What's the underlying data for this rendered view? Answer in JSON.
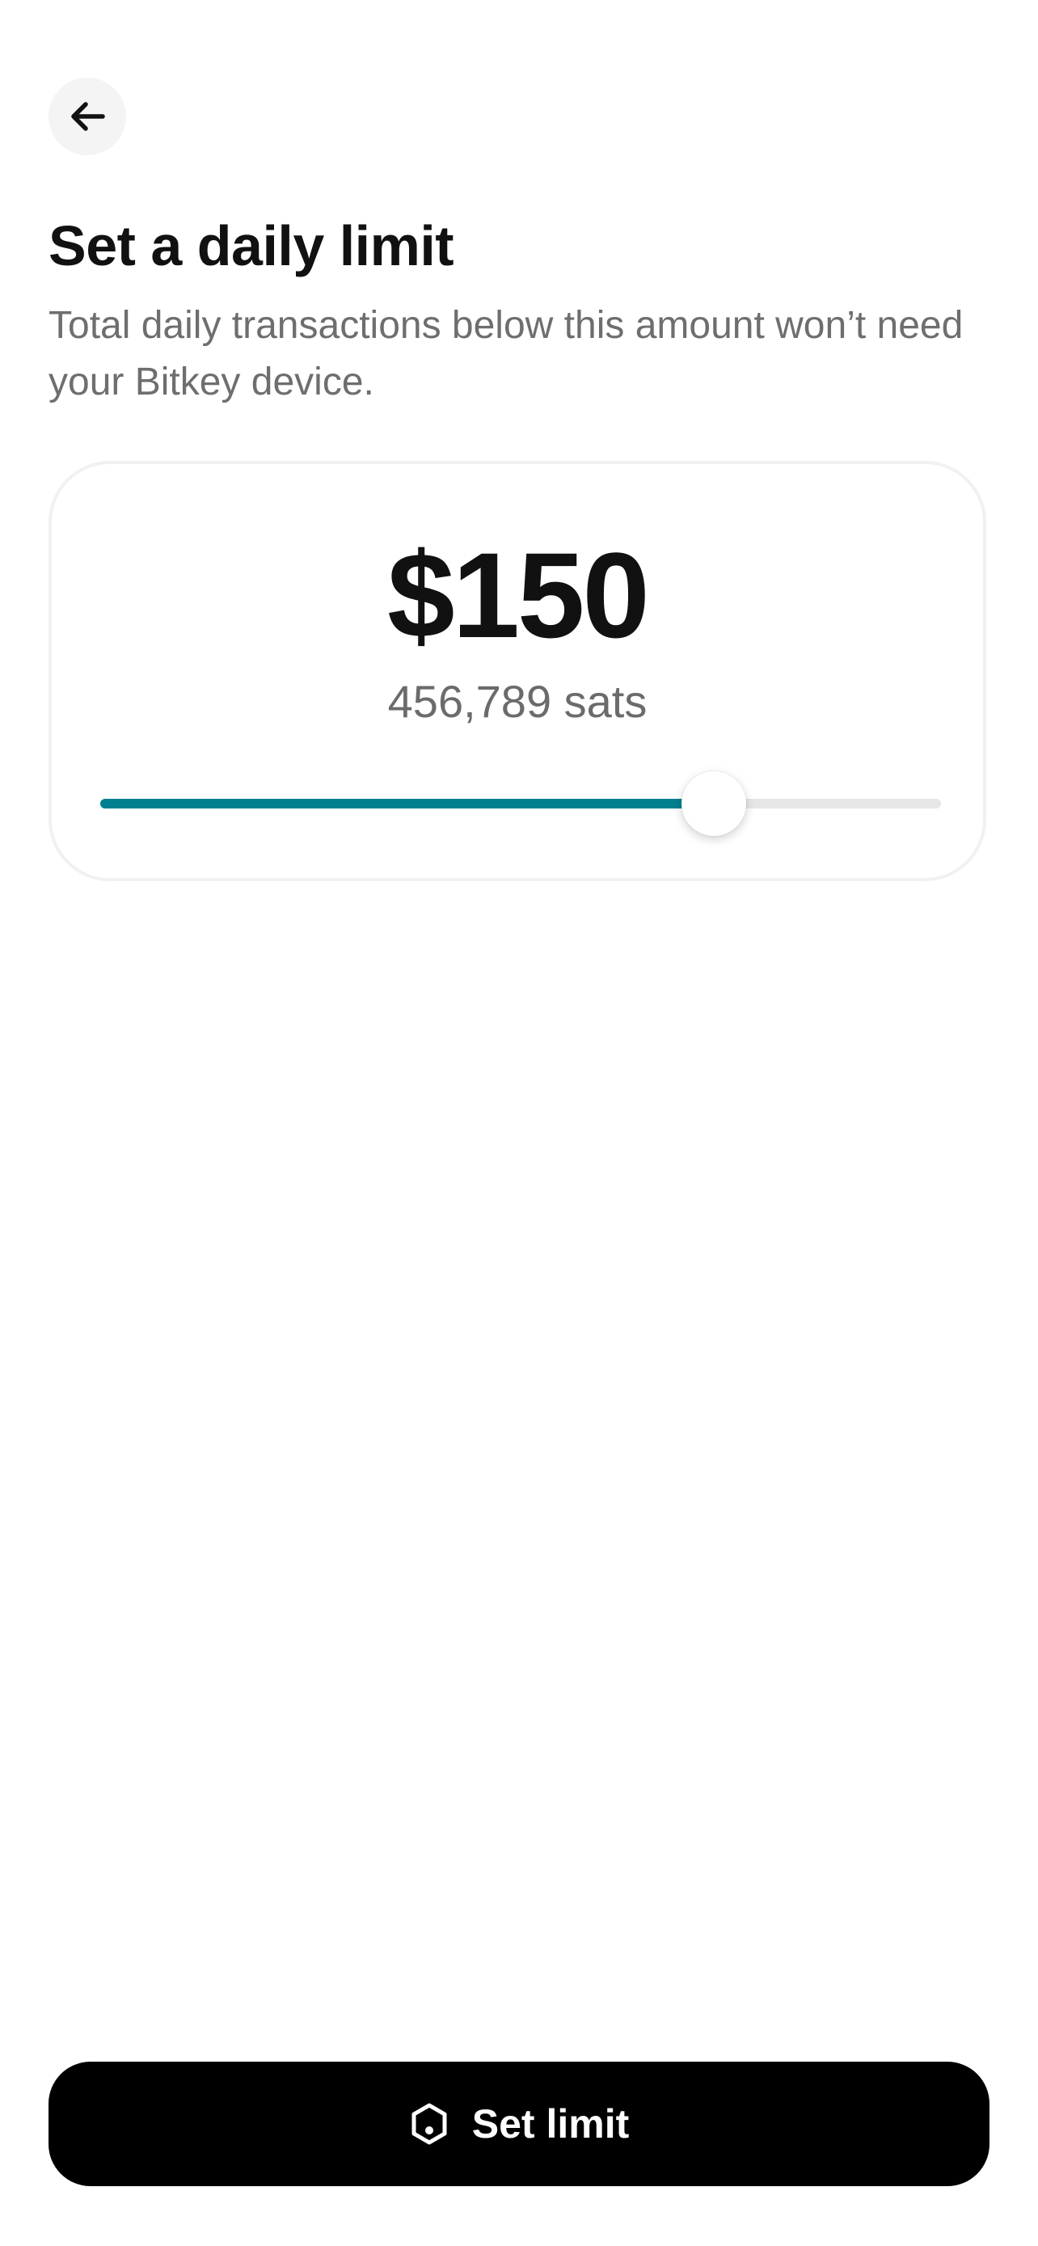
{
  "header": {
    "back_icon": "arrow-left-icon"
  },
  "page": {
    "title": "Set a daily limit",
    "subtitle": "Total daily transactions below this amount won’t need your Bitkey device."
  },
  "limit_card": {
    "fiat_amount": "$150",
    "sats_amount": "456,789 sats",
    "slider": {
      "value_fraction": 0.73
    }
  },
  "primary_action": {
    "label": "Set limit",
    "icon": "bitkey-device-icon"
  },
  "colors": {
    "accent": "#00808f",
    "button_bg": "#000000",
    "track": "#e6e6e6"
  }
}
